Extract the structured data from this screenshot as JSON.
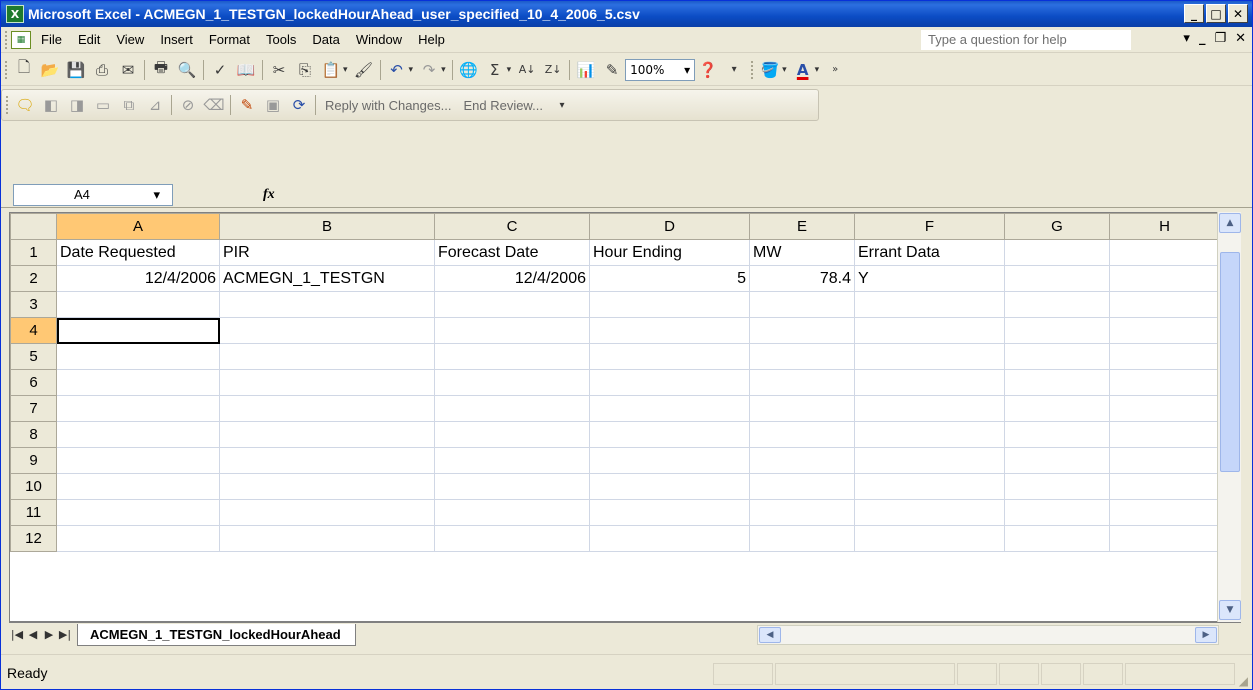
{
  "window": {
    "title": "Microsoft Excel - ACMEGN_1_TESTGN_lockedHourAhead_user_specified_10_4_2006_5.csv",
    "min_glyph": "_",
    "max_glyph": "□",
    "close_glyph": "✕"
  },
  "menu": {
    "items": [
      "File",
      "Edit",
      "View",
      "Insert",
      "Format",
      "Tools",
      "Data",
      "Window",
      "Help"
    ],
    "help_placeholder": "Type a question for help"
  },
  "toolbar": {
    "zoom": "100%",
    "reply_label": "Reply with Changes...",
    "end_review_label": "End Review..."
  },
  "formula_bar": {
    "name_box": "A4",
    "fx": "fx",
    "formula": ""
  },
  "grid": {
    "columns": [
      "A",
      "B",
      "C",
      "D",
      "E",
      "F",
      "G",
      "H"
    ],
    "rows": [
      [
        "Date Requested",
        "PIR",
        "Forecast Date",
        "Hour Ending",
        "MW",
        "Errant Data",
        "",
        ""
      ],
      [
        "12/4/2006",
        "ACMEGN_1_TESTGN",
        "12/4/2006",
        "5",
        "78.4",
        "Y",
        "",
        ""
      ],
      [
        "",
        "",
        "",
        "",
        "",
        "",
        "",
        ""
      ],
      [
        "",
        "",
        "",
        "",
        "",
        "",
        "",
        ""
      ],
      [
        "",
        "",
        "",
        "",
        "",
        "",
        "",
        ""
      ],
      [
        "",
        "",
        "",
        "",
        "",
        "",
        "",
        ""
      ],
      [
        "",
        "",
        "",
        "",
        "",
        "",
        "",
        ""
      ],
      [
        "",
        "",
        "",
        "",
        "",
        "",
        "",
        ""
      ],
      [
        "",
        "",
        "",
        "",
        "",
        "",
        "",
        ""
      ],
      [
        "",
        "",
        "",
        "",
        "",
        "",
        "",
        ""
      ],
      [
        "",
        "",
        "",
        "",
        "",
        "",
        "",
        ""
      ],
      [
        "",
        "",
        "",
        "",
        "",
        "",
        "",
        ""
      ]
    ],
    "active_cell": "A4"
  },
  "sheet": {
    "tab_name": "ACMEGN_1_TESTGN_lockedHourAhead"
  },
  "status": {
    "text": "Ready"
  }
}
